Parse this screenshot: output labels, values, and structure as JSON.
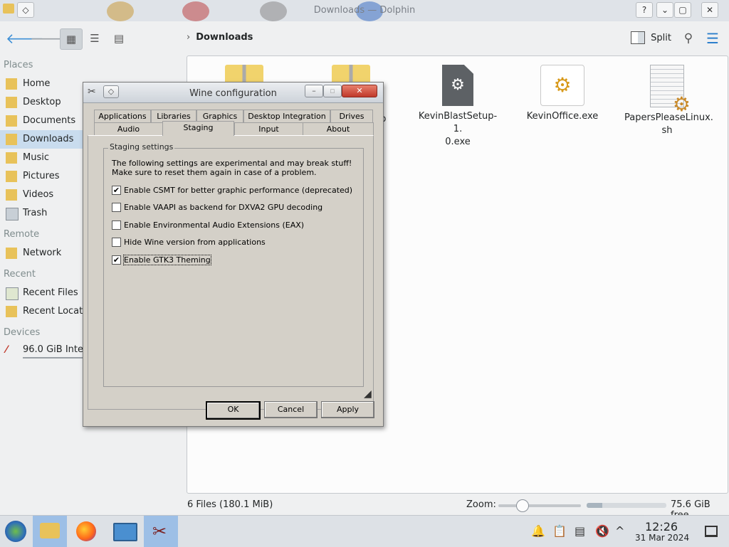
{
  "window": {
    "title": "Downloads — Dolphin",
    "title_buttons": [
      "?",
      "⌄",
      "▢",
      "✕"
    ]
  },
  "toolbar": {
    "breadcrumb": "Downloads",
    "split_label": "Split",
    "icons": [
      "back-arrow-icon",
      "forward-arrow-icon",
      "icons-view-icon",
      "compact-view-icon",
      "details-view-icon",
      "search-icon",
      "menu-icon"
    ]
  },
  "sidebar": {
    "sections": {
      "places": "Places",
      "remote": "Remote",
      "recent": "Recent",
      "devices": "Devices"
    },
    "places": [
      {
        "label": "Home",
        "icon": "home-folder-icon"
      },
      {
        "label": "Desktop",
        "icon": "desktop-folder-icon"
      },
      {
        "label": "Documents",
        "icon": "documents-folder-icon"
      },
      {
        "label": "Downloads",
        "icon": "downloads-folder-icon",
        "selected": true
      },
      {
        "label": "Music",
        "icon": "music-folder-icon"
      },
      {
        "label": "Pictures",
        "icon": "pictures-folder-icon"
      },
      {
        "label": "Videos",
        "icon": "videos-folder-icon"
      },
      {
        "label": "Trash",
        "icon": "trash-icon"
      }
    ],
    "remote": [
      {
        "label": "Network",
        "icon": "network-icon"
      }
    ],
    "recent": [
      {
        "label": "Recent Files",
        "icon": "recent-files-icon"
      },
      {
        "label": "Recent Locatio",
        "icon": "recent-locations-icon"
      }
    ],
    "devices": [
      {
        "label": "96.0 GiB Intern",
        "icon": "drive-icon"
      }
    ]
  },
  "files": [
    {
      "name": "",
      "icon": "archive-icon"
    },
    {
      "name": "zip",
      "icon": "archive-icon"
    },
    {
      "name": "KevinBlastSetup-1.0.exe",
      "line1": "KevinBlastSetup-1.",
      "line2": "0.exe",
      "icon": "executable-gear-icon"
    },
    {
      "name": "KevinOffice.exe",
      "line1": "KevinOffice.exe",
      "line2": "",
      "icon": "wine-exe-icon"
    },
    {
      "name": "PapersPleaseLinux.sh",
      "line1": "PapersPleaseLinux.",
      "line2": "sh",
      "icon": "shell-script-icon"
    }
  ],
  "statusbar": {
    "summary": "6 Files (180.1 MiB)",
    "zoom_label": "Zoom:",
    "zoom_level": 0.25,
    "free_space": "75.6 GiB free",
    "free_fraction": 0.2
  },
  "taskbar": {
    "time": "12:26",
    "date": "31 Mar 2024"
  },
  "wine_dialog": {
    "title": "Wine configuration",
    "tabs_row1": [
      "Applications",
      "Libraries",
      "Graphics",
      "Desktop Integration",
      "Drives"
    ],
    "tabs_row2": [
      "Audio",
      "Staging",
      "Input",
      "About"
    ],
    "selected_tab": "Staging",
    "group_label": "Staging settings",
    "intro_line1": "The following settings are experimental and may break stuff!",
    "intro_line2": "Make sure to reset them again in case of a problem.",
    "options": [
      {
        "label": "Enable CSMT for better graphic performance (deprecated)",
        "checked": true
      },
      {
        "label": "Enable VAAPI as backend for DXVA2 GPU decoding",
        "checked": false
      },
      {
        "label": "Enable Environmental Audio Extensions (EAX)",
        "checked": false
      },
      {
        "label": "Hide Wine version from applications",
        "checked": false
      },
      {
        "label": "Enable GTK3 Theming",
        "checked": true,
        "focused": true
      }
    ],
    "buttons": {
      "ok": "OK",
      "cancel": "Cancel",
      "apply": "Apply"
    }
  }
}
